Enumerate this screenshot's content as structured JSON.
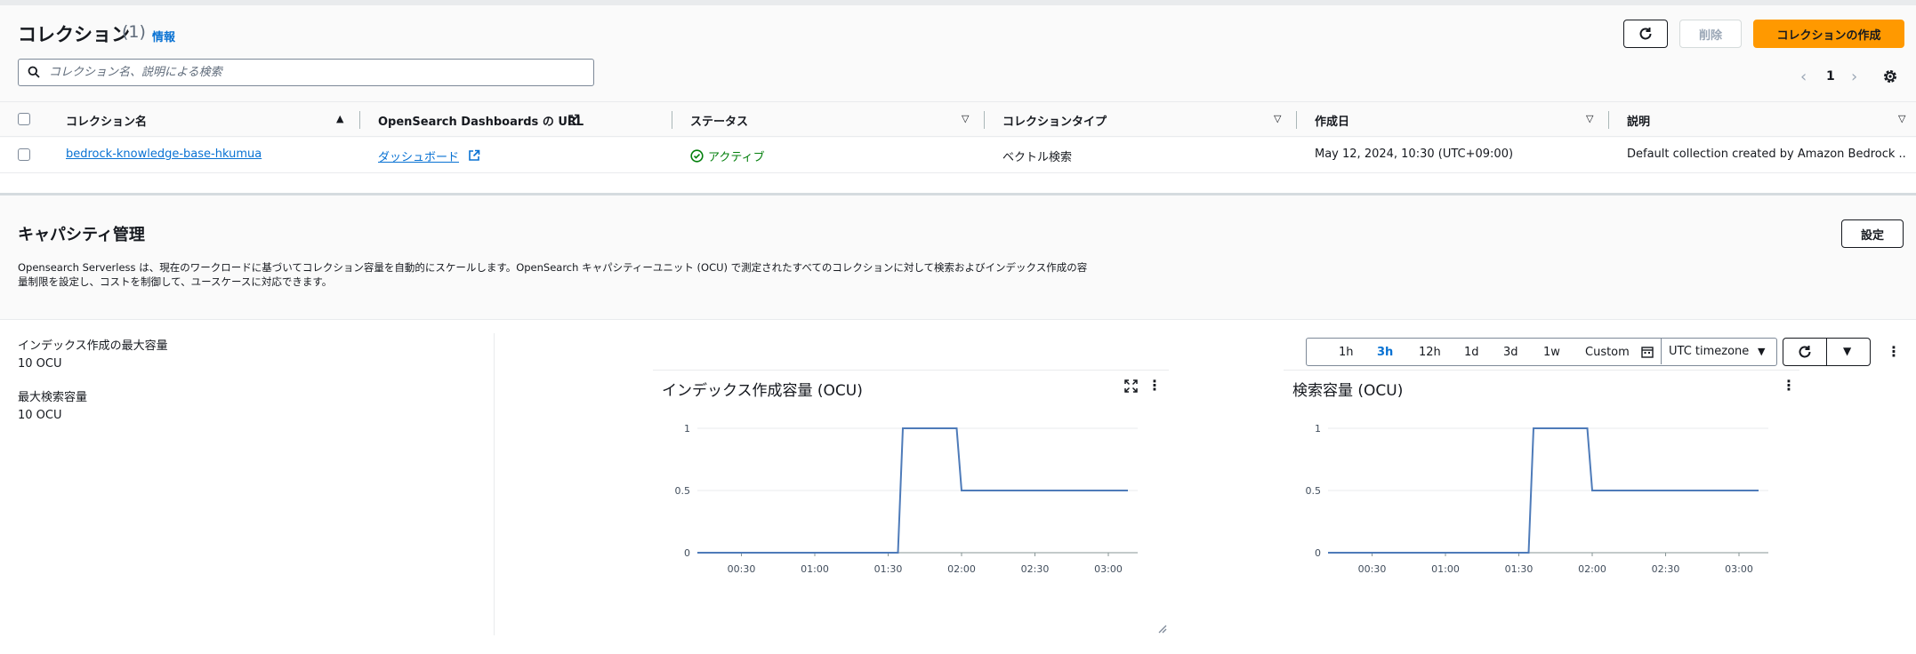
{
  "collections": {
    "title": "コレクション",
    "count": "(1)",
    "info_label": "情報",
    "delete_label": "削除",
    "create_label": "コレクションの作成",
    "search_placeholder": "コレクション名、説明による検索",
    "page": "1",
    "columns": [
      "コレクション名",
      "OpenSearch Dashboards の URL",
      "ステータス",
      "コレクションタイプ",
      "作成日",
      "説明"
    ],
    "rows": [
      {
        "name": "bedrock-knowledge-base-hkumua",
        "dashboard": "ダッシュボード",
        "status": "アクティブ",
        "type": "ベクトル検索",
        "created": "May 12, 2024, 10:30 (UTC+09:00)",
        "description": "Default collection created by Amazon Bedrock ..."
      }
    ]
  },
  "capacity": {
    "title": "キャパシティ管理",
    "settings_label": "設定",
    "description": "Opensearch Serverless は、現在のワークロードに基づいてコレクション容量を自動的にスケールします。OpenSearch キャパシティーユニット (OCU) で測定されたすべてのコレクションに対して検索およびインデックス作成の容量制限を設定し、コストを制御して、ユースケースに対応できます。",
    "max_index_label": "インデックス作成の最大容量",
    "max_index_value": "10 OCU",
    "max_search_label": "最大検索容量",
    "max_search_value": "10 OCU"
  },
  "time_range": {
    "options": [
      "1h",
      "3h",
      "12h",
      "1d",
      "3d",
      "1w",
      "Custom"
    ],
    "selected": "3h",
    "timezone": "UTC timezone"
  },
  "charts": [
    {
      "title": "インデックス作成容量 (OCU)",
      "x_ticks": [
        "00:30",
        "01:00",
        "01:30",
        "02:00",
        "02:30",
        "03:00"
      ],
      "y_ticks": [
        "1",
        "0.5",
        "0"
      ]
    },
    {
      "title": "検索容量 (OCU)",
      "x_ticks": [
        "00:30",
        "01:00",
        "01:30",
        "02:00",
        "02:30",
        "03:00"
      ],
      "y_ticks": [
        "1",
        "0.5",
        "0"
      ]
    }
  ],
  "chart_data": [
    {
      "type": "line",
      "title": "インデックス作成容量 (OCU)",
      "ylim": [
        0,
        1
      ],
      "x": [
        "00:12",
        "01:34",
        "01:36",
        "01:58",
        "02:00",
        "03:08"
      ],
      "series": [
        {
          "values": [
            0,
            0,
            1,
            1,
            0.5,
            0.5
          ]
        }
      ],
      "color": "#4e7bb9"
    },
    {
      "type": "line",
      "title": "検索容量 (OCU)",
      "ylim": [
        0,
        1
      ],
      "x": [
        "00:12",
        "01:34",
        "01:36",
        "01:58",
        "02:00",
        "03:08"
      ],
      "series": [
        {
          "values": [
            0,
            0,
            1,
            1,
            0.5,
            0.5
          ]
        }
      ],
      "color": "#4e7bb9"
    }
  ]
}
